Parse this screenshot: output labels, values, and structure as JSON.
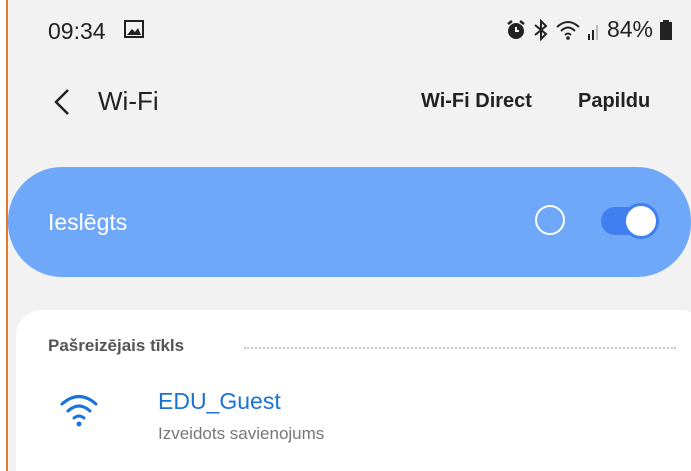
{
  "status_bar": {
    "time": "09:34",
    "battery_percent": "84%",
    "icons": [
      "image-icon",
      "alarm-icon",
      "bluetooth-icon",
      "wifi-signal-icon",
      "cell-signal-icon",
      "battery-icon"
    ]
  },
  "header": {
    "title": "Wi-Fi",
    "wifi_direct_label": "Wi-Fi Direct",
    "more_label": "Papildu"
  },
  "wifi_toggle": {
    "label": "Ieslēgts",
    "enabled": true
  },
  "current_network": {
    "section_title": "Pašreizējais tīkls",
    "ssid": "EDU_Guest",
    "status": "Izveidots savienojums"
  },
  "colors": {
    "toggle_card": "#6fa8f8",
    "switch_on": "#3f7ff0",
    "ssid": "#1a73d8",
    "border": "#e07a2a"
  }
}
